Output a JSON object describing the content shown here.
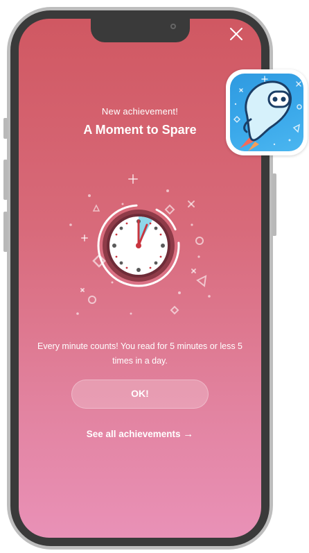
{
  "dialog": {
    "subtitle": "New achievement!",
    "title": "A Moment to Spare",
    "description": "Every minute counts! You read for 5 minutes or less 5 times in a day.",
    "ok_label": "OK!",
    "see_all_label": "See all achievements",
    "see_all_arrow": "→"
  },
  "icons": {
    "close": "close-icon",
    "badge": "clock-badge-icon",
    "app": "sora-app-icon"
  },
  "colors": {
    "gradient_top": "#d05862",
    "gradient_bottom": "#e991b7",
    "text": "#ffffff",
    "clock_ring": "#8e3b48",
    "clock_hand": "#c9353f",
    "clock_highlight": "#8fd7ea",
    "app_icon_bg": "#3aa8ea"
  }
}
